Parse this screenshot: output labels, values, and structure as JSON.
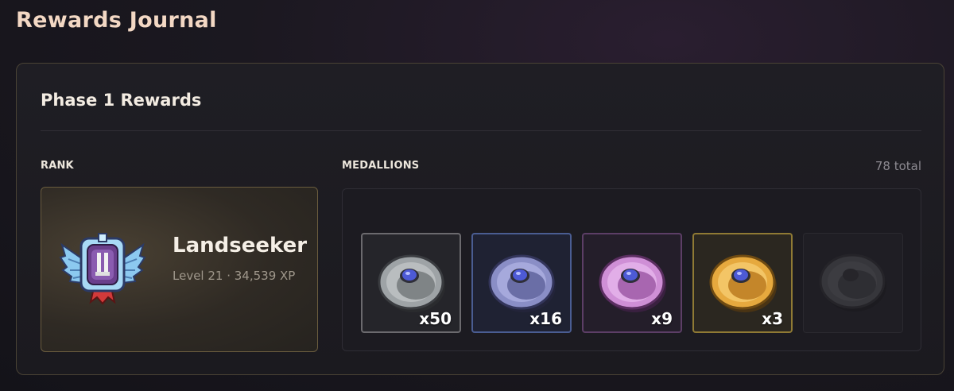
{
  "page": {
    "title": "Rewards Journal"
  },
  "panel": {
    "title": "Phase 1 Rewards"
  },
  "rank": {
    "section_label": "RANK",
    "name": "Landseeker",
    "level_text": "Level 21 · 34,539 XP",
    "badge_icon": "winged-shield-badge-icon"
  },
  "medallions": {
    "section_label": "MEDALLIONS",
    "total": "78 total",
    "items": [
      {
        "tier": "silver",
        "count": "x50",
        "icon": "silver-medallion-icon",
        "color": "#9ea3a6"
      },
      {
        "tier": "blue",
        "count": "x16",
        "icon": "blue-medallion-icon",
        "color": "#8a8ec6"
      },
      {
        "tier": "purple",
        "count": "x9",
        "icon": "purple-medallion-icon",
        "color": "#cf8fd6"
      },
      {
        "tier": "gold",
        "count": "x3",
        "icon": "gold-medallion-icon",
        "color": "#e6a93e"
      },
      {
        "tier": "locked",
        "count": "",
        "icon": "locked-medallion-icon",
        "color": "#4a4a4e"
      }
    ]
  },
  "colors": {
    "title": "#f3d8c4",
    "panel_border": "#4a4335",
    "rank_card_border": "#6a5c3e",
    "muted_text": "#8d8a91"
  }
}
